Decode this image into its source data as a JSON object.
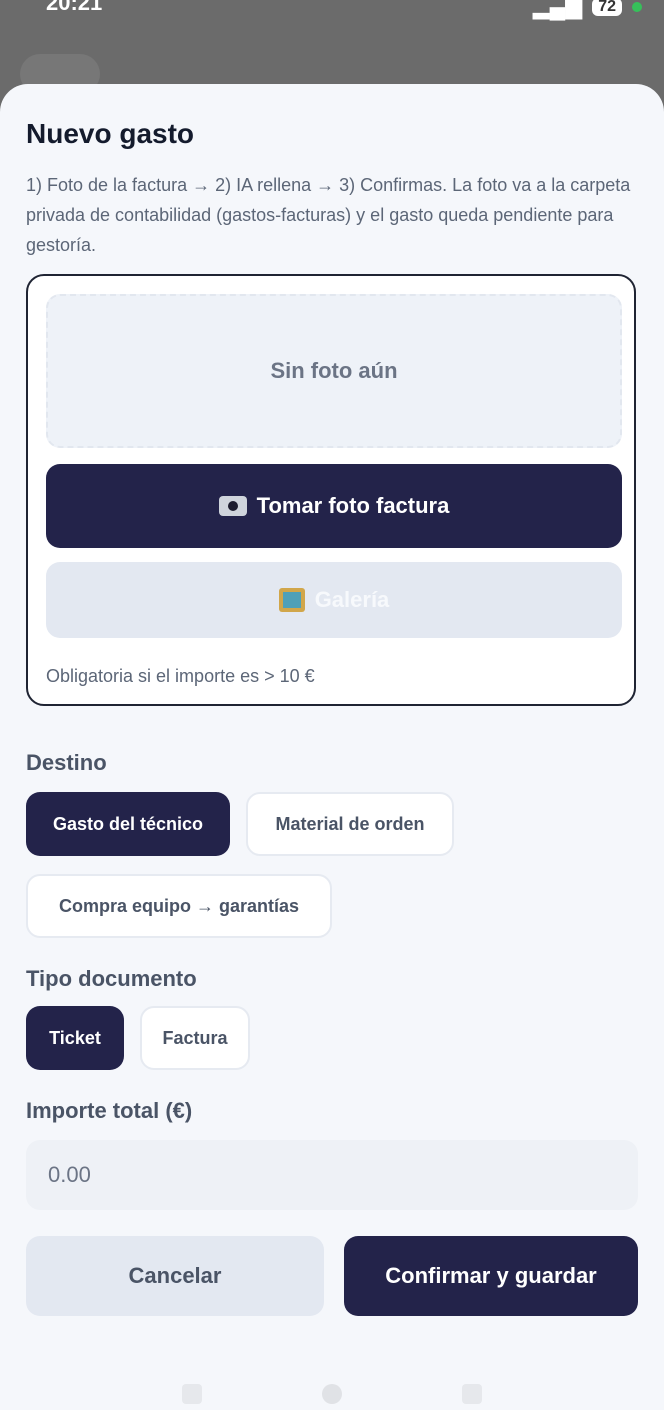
{
  "status_bar": {
    "time": "20:21",
    "battery": "72"
  },
  "sheet": {
    "title": "Nuevo gasto",
    "description": "1) Foto de la factura → 2) IA rellena → 3) Confirmas. La foto va a la carpeta privada de contabilidad (gastos-facturas) y el gasto queda pendiente para gestoría.",
    "photo": {
      "placeholder": "Sin foto aún",
      "take_photo_label": "Tomar foto factura",
      "gallery_label": "Galería",
      "note": "Obligatoria si el importe es > 10 €"
    },
    "destino": {
      "label": "Destino",
      "options": [
        "Gasto del técnico",
        "Material de orden",
        "Compra equipo → garantías"
      ],
      "selected": "Gasto del técnico"
    },
    "tipo_documento": {
      "label": "Tipo documento",
      "options": [
        "Ticket",
        "Factura"
      ],
      "selected": "Ticket"
    },
    "importe": {
      "label": "Importe total (€)",
      "placeholder": "0.00"
    },
    "actions": {
      "cancel": "Cancelar",
      "confirm": "Confirmar y guardar"
    }
  },
  "colors": {
    "primary": "#23234a",
    "surface": "#f5f7fb",
    "muted_button": "#e3e8f1",
    "text_muted": "#5c6677"
  }
}
